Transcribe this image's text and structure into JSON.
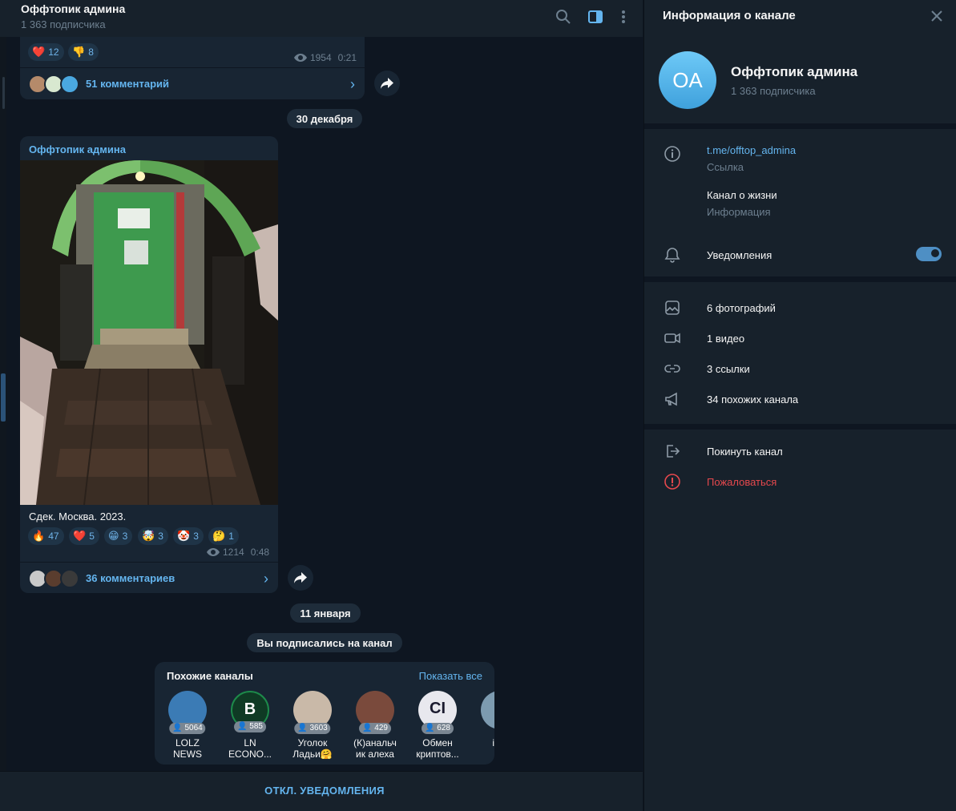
{
  "chat": {
    "title": "Оффтопик админа",
    "subscribers": "1 363 подписчика",
    "mute_button": "ОТКЛ. УВЕДОМЛЕНИЯ"
  },
  "post1": {
    "reactions": [
      {
        "emoji": "❤️",
        "count": "12"
      },
      {
        "emoji": "👎",
        "count": "8"
      }
    ],
    "views": "1954",
    "time": "0:21",
    "comments": "51 комментарий"
  },
  "date1": "30 декабря",
  "post2": {
    "author": "Оффтопик админа",
    "caption": "Сдек. Москва. 2023.",
    "reactions": [
      {
        "emoji": "🔥",
        "count": "47"
      },
      {
        "emoji": "❤️",
        "count": "5"
      },
      {
        "emoji": "😁",
        "count": "3"
      },
      {
        "emoji": "🤯",
        "count": "3"
      },
      {
        "emoji": "🤡",
        "count": "3"
      },
      {
        "emoji": "🤔",
        "count": "1"
      }
    ],
    "views": "1214",
    "time": "0:48",
    "comments": "36 комментариев"
  },
  "date2": "11 января",
  "service_message": "Вы подписались на канал",
  "similar": {
    "title": "Похожие каналы",
    "show_all": "Показать все",
    "channels": [
      {
        "name1": "LOLZ",
        "name2": "NEWS",
        "count": "5064",
        "color": "#3b7bb5"
      },
      {
        "name1": "LN",
        "name2": "ECONO...",
        "count": "585",
        "color": "#1d8a4a"
      },
      {
        "name1": "Уголок",
        "name2": "Ладьи🤗",
        "count": "3603",
        "color": "#c9b9a8"
      },
      {
        "name1": "(К)анальч",
        "name2": "ик алеха",
        "count": "429",
        "color": "#7a4a3c"
      },
      {
        "name1": "Обмен",
        "name2": "криптов...",
        "count": "628",
        "color": "#e8e8ee"
      },
      {
        "name1": "ivar",
        "name2": "l",
        "count": "",
        "color": "#7d9bb0"
      }
    ]
  },
  "info": {
    "title": "Информация о канале",
    "avatar_initials": "OA",
    "name": "Оффтопик админа",
    "subscribers": "1 363 подписчика",
    "link": "t.me/offtop_admina",
    "link_label": "Ссылка",
    "description": "Канал о жизни",
    "description_label": "Информация",
    "notifications": "Уведомления",
    "notifications_on": true,
    "media": [
      {
        "icon": "photo-icon",
        "label": "6 фотографий"
      },
      {
        "icon": "video-icon",
        "label": "1 видео"
      },
      {
        "icon": "link-icon",
        "label": "3 ссылки"
      },
      {
        "icon": "megaphone-icon",
        "label": "34 похожих канала"
      }
    ],
    "leave": "Покинуть канал",
    "report": "Пожаловаться"
  }
}
